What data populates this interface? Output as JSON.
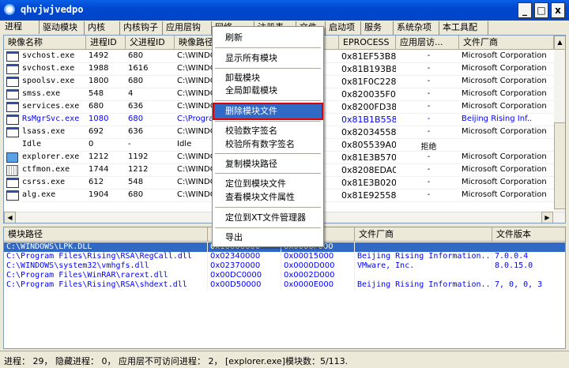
{
  "window": {
    "title": "qhvjwjvedpo",
    "min": "_",
    "max": "□",
    "close": "x"
  },
  "tabs": [
    "进程",
    "驱动模块",
    "内核",
    "内核钩子",
    "应用层钩子",
    "网络",
    "注册表",
    "文件",
    "启动项",
    "服务",
    "系统杂项",
    "本工具配置"
  ],
  "process_table": {
    "columns": [
      "映像名称",
      "进程ID",
      "父进程ID",
      "映像路径",
      "EPROCESS",
      "应用层访...",
      "文件厂商"
    ],
    "rows": [
      {
        "name": "svchost.exe",
        "pid": "1492",
        "ppid": "680",
        "path": "C:\\WINDOWS",
        "eprocess": "0x81EF53B8",
        "access": "-",
        "vendor": "Microsoft Corporation",
        "icon": "window"
      },
      {
        "name": "svchost.exe",
        "pid": "1988",
        "ppid": "1616",
        "path": "C:\\WINDOWS",
        "eprocess": "0x81B193B8",
        "access": "-",
        "vendor": "Microsoft Corporation",
        "icon": "window"
      },
      {
        "name": "spoolsv.exe",
        "pid": "1800",
        "ppid": "680",
        "path": "C:\\WINDOWS",
        "eprocess": "0x81F0C228",
        "access": "-",
        "vendor": "Microsoft Corporation",
        "icon": "window"
      },
      {
        "name": "smss.exe",
        "pid": "548",
        "ppid": "4",
        "path": "C:\\WINDOWS",
        "eprocess": "0x820035F0",
        "access": "-",
        "vendor": "Microsoft Corporation",
        "icon": "window"
      },
      {
        "name": "services.exe",
        "pid": "680",
        "ppid": "636",
        "path": "C:\\WINDOWS",
        "eprocess": "0x8200FD38",
        "access": "-",
        "vendor": "Microsoft Corporation",
        "icon": "window"
      },
      {
        "name": "RsMgrSvc.exe",
        "pid": "1080",
        "ppid": "680",
        "path": "C:\\Program",
        "eprocess": "0x81B1B558",
        "access": "-",
        "vendor": "Beijing Rising Inf..",
        "icon": "window",
        "blue": true
      },
      {
        "name": "lsass.exe",
        "pid": "692",
        "ppid": "636",
        "path": "C:\\WINDOWS",
        "eprocess": "0x82034558",
        "access": "-",
        "vendor": "Microsoft Corporation",
        "icon": "window"
      },
      {
        "name": "Idle",
        "pid": "0",
        "ppid": "-",
        "path": "Idle",
        "eprocess": "0x805539A0",
        "access": "拒绝",
        "vendor": "",
        "icon": "none"
      },
      {
        "name": "explorer.exe",
        "pid": "1212",
        "ppid": "1192",
        "path": "C:\\WINDOWS",
        "eprocess": "0x81E3B570",
        "access": "-",
        "vendor": "Microsoft Corporation",
        "icon": "computer"
      },
      {
        "name": "ctfmon.exe",
        "pid": "1744",
        "ppid": "1212",
        "path": "C:\\WINDOWS",
        "eprocess": "0x8208EDA0",
        "access": "-",
        "vendor": "Microsoft Corporation",
        "icon": "pen"
      },
      {
        "name": "csrss.exe",
        "pid": "612",
        "ppid": "548",
        "path": "C:\\WINDOWS",
        "eprocess": "0x81E3B020",
        "access": "-",
        "vendor": "Microsoft Corporation",
        "icon": "window"
      },
      {
        "name": "alg.exe",
        "pid": "1904",
        "ppid": "680",
        "path": "C:\\WINDOWS",
        "eprocess": "0x81E92558",
        "access": "-",
        "vendor": "Microsoft Corporation",
        "icon": "window"
      }
    ]
  },
  "module_table": {
    "columns": [
      "模块路径",
      "",
      "",
      "文件厂商",
      "文件版本"
    ],
    "rows": [
      {
        "path": "C:\\WINDOWS\\LPK.DLL",
        "base": "0x10000000",
        "size": "0x0000F000",
        "vendor": "",
        "version": "",
        "selected": true
      },
      {
        "path": "C:\\Program Files\\Rising\\RSA\\RegCall.dll",
        "base": "0x02340000",
        "size": "0x00015000",
        "vendor": "Beijing Rising Information...",
        "version": "7.0.0.4"
      },
      {
        "path": "C:\\WINDOWS\\system32\\vmhgfs.dll",
        "base": "0x02370000",
        "size": "0x0000D000",
        "vendor": "VMware, Inc.",
        "version": "8.0.15.0"
      },
      {
        "path": "C:\\Program Files\\WinRAR\\rarext.dll",
        "base": "0x00DC0000",
        "size": "0x0002D000",
        "vendor": "",
        "version": ""
      },
      {
        "path": "C:\\Program Files\\Rising\\RSA\\shdext.dll",
        "base": "0x00D50000",
        "size": "0x0000E000",
        "vendor": "Beijing Rising Information...",
        "version": "7, 0, 0, 3"
      }
    ]
  },
  "context_menu": {
    "items": [
      "刷新",
      "显示所有模块",
      "卸载模块",
      "全局卸载模块",
      "删除模块文件",
      "校验数字签名",
      "校验所有数字签名",
      "复制模块路径",
      "定位到模块文件",
      "查看模块文件属性",
      "定位到XT文件管理器",
      "导出"
    ],
    "highlighted": "删除模块文件"
  },
  "status": "进程： 29， 隐藏进程： 0， 应用层不可访问进程： 2， [explorer.exe]模块数：5/113.",
  "colors": {
    "title_bar": "#0054e3",
    "selection": "#316ac5",
    "highlight_border": "#e00000",
    "link_text": "#0000ff"
  }
}
